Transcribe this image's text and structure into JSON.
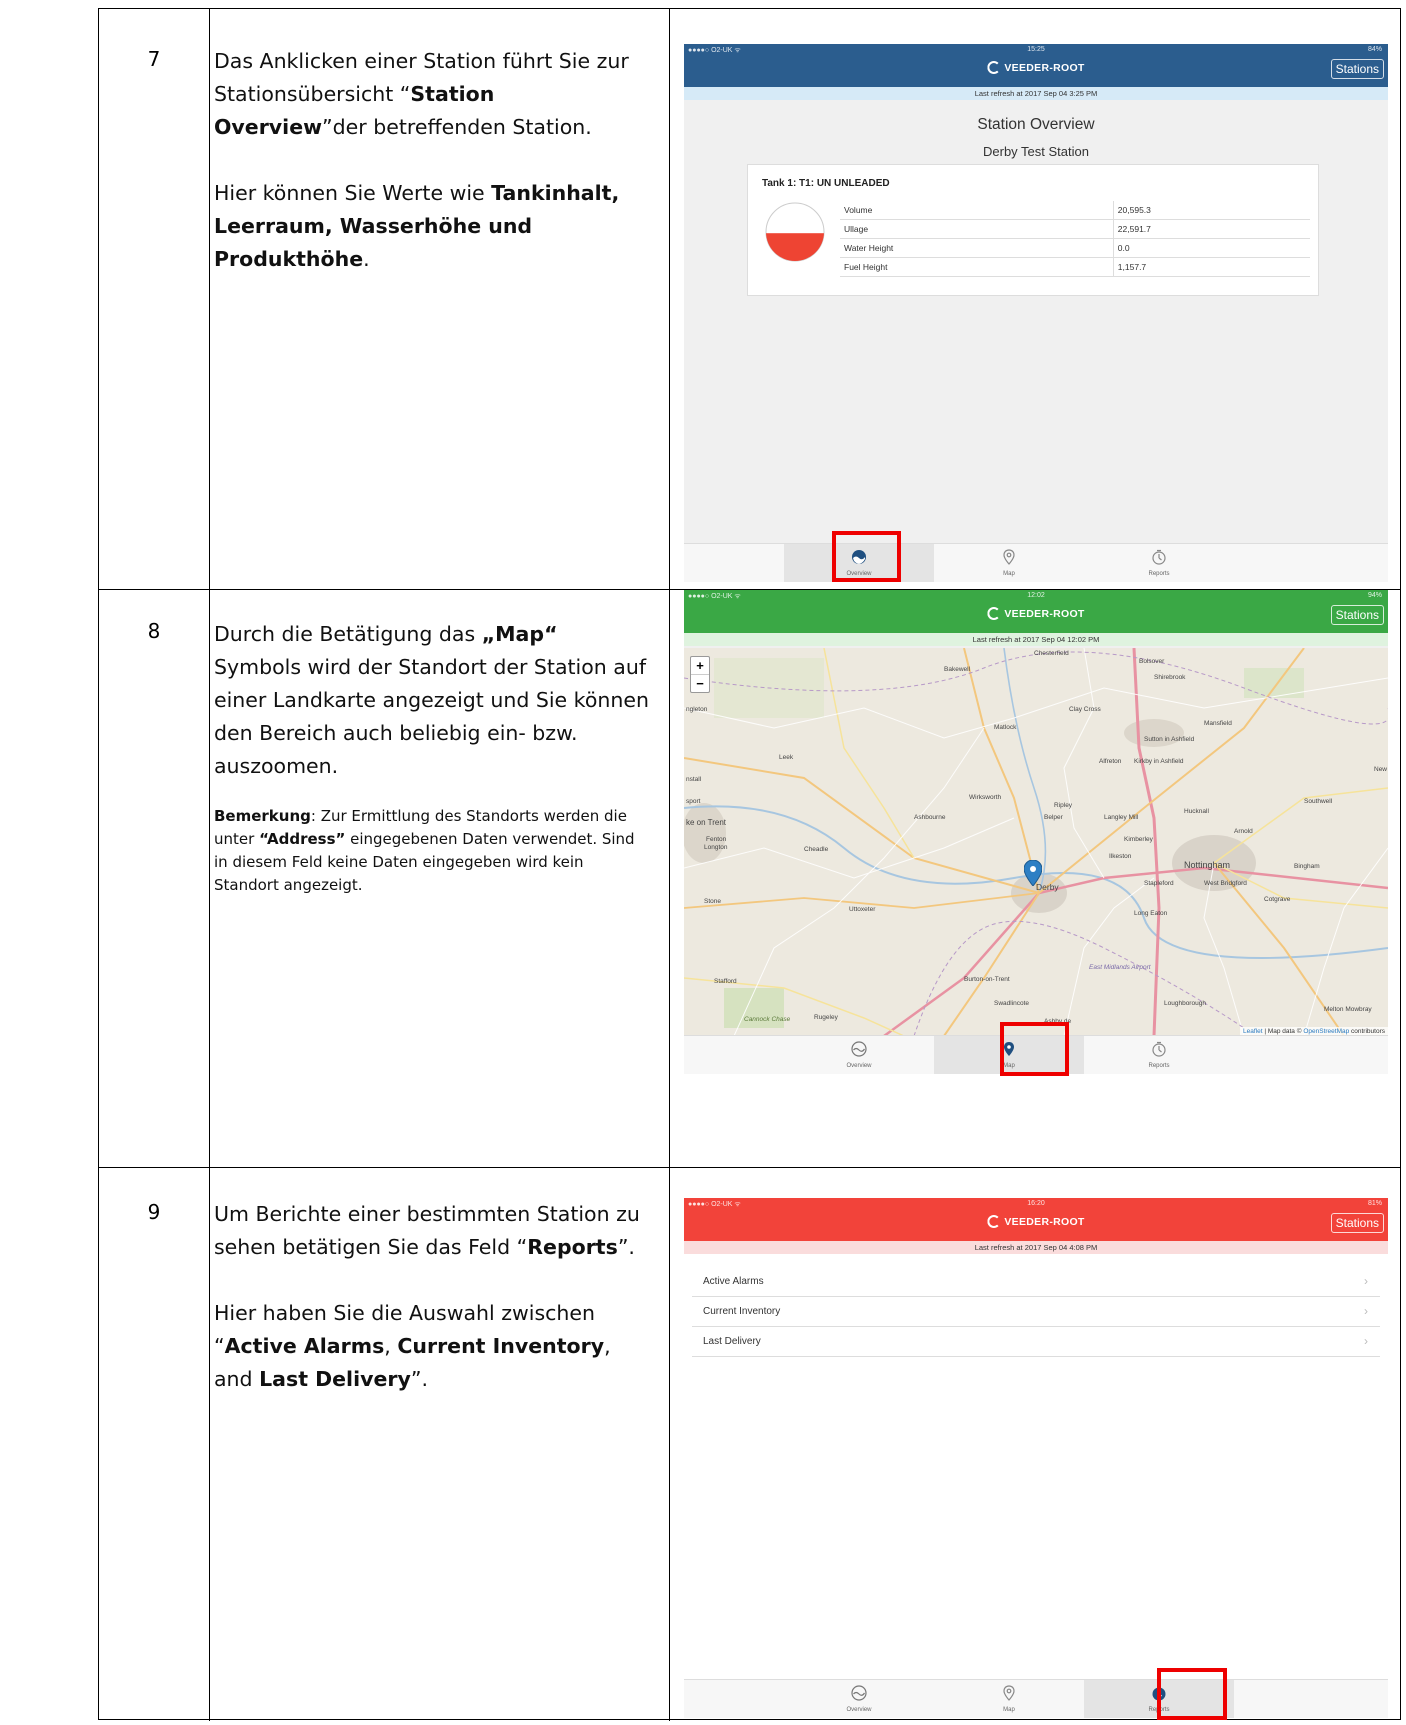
{
  "rows": [
    {
      "number": "7",
      "text_a": "Das Anklicken einer Station führt Sie zur Stationsübersicht “",
      "text_a_bold": "Station Overview",
      "text_a_end": "”der betreffenden Station.",
      "text_b": "Hier können Sie Werte wie ",
      "text_b_bold": "Tankinhalt, Leerraum, Wasserhöhe und Produkthöhe",
      "text_b_end": "."
    },
    {
      "number": "8",
      "text_a": "Durch die Betätigung das ",
      "text_a_bold": "„Map“",
      "text_a_end": " Symbols wird der Standort der Station auf einer Landkarte angezeigt und Sie können den Bereich auch beliebig ein- bzw. auszoomen.",
      "note_bold": "Bemerkung",
      "note_a": ": Zur Ermittlung des Standorts werden die unter ",
      "note_bold2": "“Address”",
      "note_b": " eingegebenen Daten verwendet. Sind in diesem Feld keine Daten eingegeben wird kein Standort angezeigt."
    },
    {
      "number": "9",
      "text_a": "Um Berichte einer bestimmten Station zu sehen betätigen Sie das Feld “",
      "text_a_bold": "Reports",
      "text_a_end": "”.",
      "text_b": "Hier haben Sie die Auswahl zwischen “",
      "text_b_bold1": "Active Alarms",
      "text_b_sep1": ", ",
      "text_b_bold2": "Current Inventory",
      "text_b_sep2": ", and ",
      "text_b_bold3": "Last Delivery",
      "text_b_end": "”."
    }
  ],
  "app": {
    "brand": "VEEDER-ROOT",
    "stations_button": "Stations",
    "carrier": "●●●●○ O2-UK ᯤ",
    "tabs": {
      "overview": "Overview",
      "map": "Map",
      "reports": "Reports"
    },
    "colors": {
      "blue": "#2b5d8e",
      "green": "#3aa845",
      "red": "#f2433a",
      "highlight": "#e00000"
    }
  },
  "screen1": {
    "time": "15:25",
    "battery": "84%",
    "refresh": "Last refresh at 2017 Sep 04 3:25 PM",
    "title": "Station Overview",
    "station_name": "Derby Test Station",
    "tank_title": "Tank 1: T1: UN UNLEADED",
    "fill_fraction": 0.48,
    "rows": [
      {
        "label": "Volume",
        "value": "20,595.3"
      },
      {
        "label": "Ullage",
        "value": "22,591.7"
      },
      {
        "label": "Water Height",
        "value": "0.0"
      },
      {
        "label": "Fuel Height",
        "value": "1,157.7"
      }
    ]
  },
  "screen2": {
    "time": "12:02",
    "battery": "94%",
    "refresh": "Last refresh at 2017 Sep 04 12:02 PM",
    "zoom_in": "+",
    "zoom_out": "−",
    "places": [
      "Chesterfield",
      "Bolsover",
      "Bakewell",
      "Shirebrook",
      "ngleton",
      "Clay Cross",
      "Matlock",
      "Mansfield",
      "Sutton in Ashfield",
      "Leek",
      "Alfreton",
      "Kirkby in Ashfield",
      "Wirksworth",
      "New",
      "Southwell",
      "nstall",
      "sport",
      "Ripley",
      "Hucknall",
      "ke on Trent",
      "Ashbourne",
      "Belper",
      "Langley Mill",
      "Arnold",
      "Fenton",
      "Longton",
      "Kimberley",
      "Cheadle",
      "Ilkeston",
      "Nottingham",
      "Bingham",
      "Derby",
      "Stapleford",
      "West Bridgford",
      "Cotgrave",
      "Stone",
      "Uttoxeter",
      "Long Eaton",
      "East Midlands Airport",
      "Stafford",
      "Burton-on-Trent",
      "Swadlincote",
      "Loughborough",
      "Melton Mowbray",
      "Cannock Chase",
      "Rugeley",
      "Ashby de"
    ],
    "attribution_leaflet": "Leaflet",
    "attribution_text": " | Map data © ",
    "attribution_osm": "OpenStreetMap",
    "attribution_end": " contributors"
  },
  "screen3": {
    "time": "16:20",
    "battery": "81%",
    "refresh": "Last refresh at 2017 Sep 04 4:08 PM",
    "items": [
      "Active Alarms",
      "Current Inventory",
      "Last Delivery"
    ]
  }
}
